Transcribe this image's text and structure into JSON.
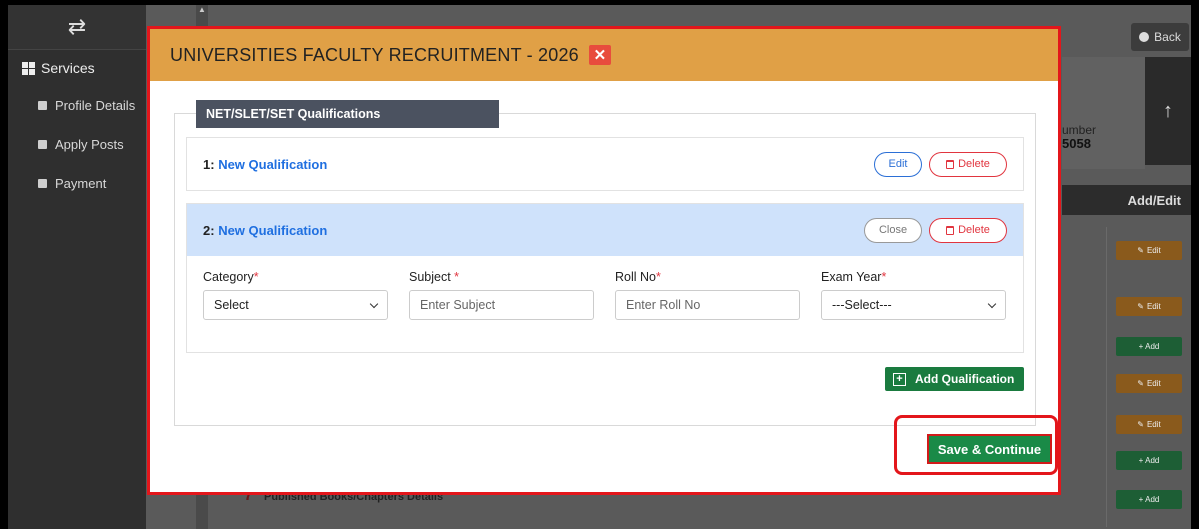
{
  "sidebar": {
    "toggle_icon": "swap-arrows-icon",
    "services_label": "Services",
    "items": [
      {
        "label": "Profile Details"
      },
      {
        "label": "Apply Posts"
      },
      {
        "label": "Payment"
      }
    ]
  },
  "background": {
    "back_label": "Back",
    "number_label": "umber",
    "number_value": "5058",
    "table_header": "Add/Edit",
    "edit_label": "Edit",
    "add_label": "+ Add",
    "row7_number": "7",
    "row7_text": "Published Books/Chapters Details"
  },
  "modal": {
    "title": "UNIVERSITIES FACULTY RECRUITMENT - 2026",
    "close_glyph": "✕",
    "section_title": "NET/SLET/SET Qualifications",
    "qualifications": [
      {
        "number": "1:",
        "title": "New Qualification",
        "primary_btn": "Edit",
        "delete_btn": "Delete"
      },
      {
        "number": "2:",
        "title": "New Qualification",
        "primary_btn": "Close",
        "delete_btn": "Delete"
      }
    ],
    "form": {
      "category_label": "Category",
      "category_value": "Select",
      "subject_label": "Subject ",
      "subject_placeholder": "Enter Subject",
      "roll_label": "Roll No",
      "roll_placeholder": "Enter Roll No",
      "year_label": "Exam Year",
      "year_value": "---Select---",
      "required_mark": "*"
    },
    "add_qualification_label": "Add Qualification",
    "save_label": "Save & Continue"
  },
  "colors": {
    "modal_header": "#e0a046",
    "highlight_border": "#e3161b",
    "save_button": "#1a8a47",
    "link_blue": "#1f6fe0"
  }
}
